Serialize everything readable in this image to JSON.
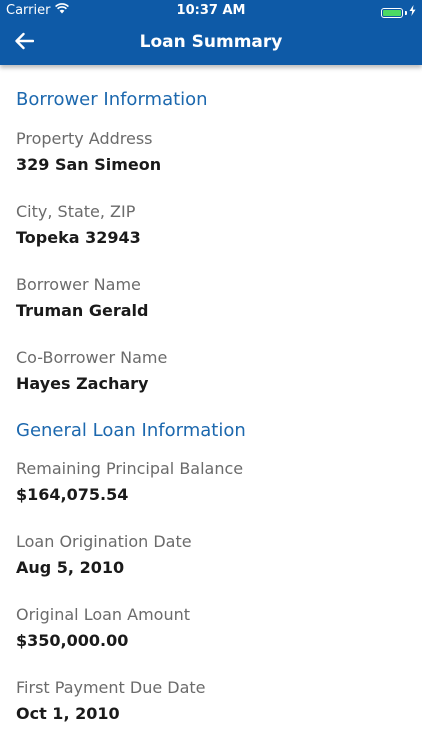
{
  "status_bar": {
    "carrier": "Carrier",
    "time": "10:37 AM",
    "wifi_icon": "wifi-icon",
    "battery_icon": "battery-icon",
    "battery_level": 1.0,
    "charging_icon": "bolt-icon"
  },
  "nav": {
    "back_icon": "arrow-left-icon",
    "title": "Loan Summary"
  },
  "colors": {
    "header_bg": "#0e5aa7",
    "section_title": "#1c68ae",
    "label": "#6b6b6b",
    "value": "#1a1a1a",
    "battery_fill": "#4cd964"
  },
  "borrower": {
    "title": "Borrower Information",
    "fields": [
      {
        "label": "Property Address",
        "value": "329 San Simeon"
      },
      {
        "label": "City, State, ZIP",
        "value": "Topeka 32943"
      },
      {
        "label": "Borrower Name",
        "value": "Truman Gerald"
      },
      {
        "label": "Co-Borrower Name",
        "value": "Hayes Zachary"
      }
    ]
  },
  "loan": {
    "title": "General Loan Information",
    "fields": [
      {
        "label": "Remaining Principal Balance",
        "value": "$164,075.54"
      },
      {
        "label": "Loan Origination Date",
        "value": "Aug 5, 2010"
      },
      {
        "label": "Original Loan Amount",
        "value": "$350,000.00"
      },
      {
        "label": "First Payment Due Date",
        "value": "Oct 1, 2010"
      }
    ]
  }
}
